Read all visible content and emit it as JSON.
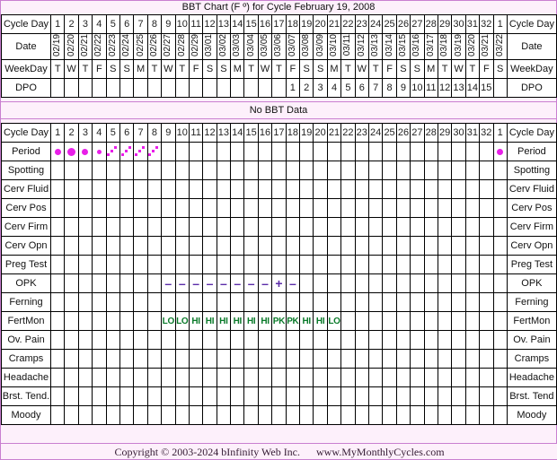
{
  "chart_data": {
    "type": "table",
    "title": "BBT Chart (F º) for Cycle February 19, 2008",
    "no_data_message": "No BBT Data",
    "cycle_days": [
      "1",
      "2",
      "3",
      "4",
      "5",
      "6",
      "7",
      "8",
      "9",
      "10",
      "11",
      "12",
      "13",
      "14",
      "15",
      "16",
      "17",
      "18",
      "19",
      "20",
      "21",
      "22",
      "23",
      "24",
      "25",
      "26",
      "27",
      "28",
      "29",
      "30",
      "31",
      "32",
      "1"
    ],
    "dates": [
      "02/19",
      "02/20",
      "02/21",
      "02/22",
      "02/23",
      "02/24",
      "02/25",
      "02/26",
      "02/27",
      "02/28",
      "02/29",
      "03/01",
      "03/02",
      "03/03",
      "03/04",
      "03/05",
      "03/06",
      "03/07",
      "03/08",
      "03/09",
      "03/10",
      "03/11",
      "03/12",
      "03/13",
      "03/14",
      "03/15",
      "03/16",
      "03/17",
      "03/18",
      "03/19",
      "03/20",
      "03/21",
      "03/22"
    ],
    "weekdays": [
      "T",
      "W",
      "T",
      "F",
      "S",
      "S",
      "M",
      "T",
      "W",
      "T",
      "F",
      "S",
      "S",
      "M",
      "T",
      "W",
      "T",
      "F",
      "S",
      "S",
      "M",
      "T",
      "W",
      "T",
      "F",
      "S",
      "S",
      "M",
      "T",
      "W",
      "T",
      "F",
      "S"
    ],
    "dpo": [
      "",
      "",
      "",
      "",
      "",
      "",
      "",
      "",
      "",
      "",
      "",
      "",
      "",
      "",
      "",
      "",
      "",
      "1",
      "2",
      "3",
      "4",
      "5",
      "6",
      "7",
      "8",
      "9",
      "10",
      "11",
      "12",
      "13",
      "14",
      "15",
      ""
    ],
    "rows": [
      {
        "label_left": "Period",
        "label_right": "Period",
        "kind": "period",
        "values": [
          "med",
          "big",
          "med",
          "sml",
          "spot",
          "spot",
          "spot",
          "spot",
          "",
          "",
          "",
          "",
          "",
          "",
          "",
          "",
          "",
          "",
          "",
          "",
          "",
          "",
          "",
          "",
          "",
          "",
          "",
          "",
          "",
          "",
          "",
          "",
          "med"
        ]
      },
      {
        "label_left": "Spotting",
        "label_right": "Spotting",
        "kind": "blank",
        "values": []
      },
      {
        "label_left": "Cerv Fluid",
        "label_right": "Cerv Fluid",
        "kind": "tall",
        "values": []
      },
      {
        "label_left": "Cerv Pos",
        "label_right": "Cerv Pos",
        "kind": "blank",
        "values": []
      },
      {
        "label_left": "Cerv Firm",
        "label_right": "Cerv Firm",
        "kind": "blank",
        "values": []
      },
      {
        "label_left": "Cerv Opn",
        "label_right": "Cerv Opn",
        "kind": "blank",
        "values": []
      },
      {
        "label_left": "Preg Test",
        "label_right": "Preg Test",
        "kind": "blank",
        "values": []
      },
      {
        "label_left": "OPK",
        "label_right": "OPK",
        "kind": "opk",
        "values": [
          "",
          "",
          "",
          "",
          "",
          "",
          "",
          "",
          "–",
          "–",
          "–",
          "–",
          "–",
          "–",
          "–",
          "–",
          "+",
          "–",
          "",
          "",
          "",
          "",
          "",
          "",
          "",
          "",
          "",
          "",
          "",
          "",
          "",
          "",
          ""
        ]
      },
      {
        "label_left": "Ferning",
        "label_right": "Ferning",
        "kind": "blank",
        "values": []
      },
      {
        "label_left": "FertMon",
        "label_right": "FertMon",
        "kind": "fertmon",
        "values": [
          "",
          "",
          "",
          "",
          "",
          "",
          "",
          "",
          "LO",
          "LO",
          "HI",
          "HI",
          "HI",
          "HI",
          "HI",
          "HI",
          "PK",
          "PK",
          "HI",
          "HI",
          "LO",
          "",
          "",
          "",
          "",
          "",
          "",
          "",
          "",
          "",
          "",
          "",
          ""
        ]
      },
      {
        "label_left": "Ov. Pain",
        "label_right": "Ov. Pain",
        "kind": "blank",
        "values": []
      },
      {
        "label_left": "Cramps",
        "label_right": "Cramps",
        "kind": "blank",
        "values": []
      },
      {
        "label_left": "Headache",
        "label_right": "Headache",
        "kind": "blank",
        "values": []
      },
      {
        "label_left": "Brst. Tend.",
        "label_right": "Brst. Tend",
        "kind": "blank",
        "values": []
      },
      {
        "label_left": "Moody",
        "label_right": "Moody",
        "kind": "blank",
        "values": []
      }
    ],
    "header_rows": {
      "cycle_day_label": "Cycle Day",
      "date_label": "Date",
      "weekday_label": "WeekDay",
      "dpo_label": "DPO"
    },
    "colors": {
      "period": "#e81ee8",
      "opk": "#5b2ca8",
      "fertmon": "#0a7a2a",
      "frame": "#c97fd0",
      "label_bg": "#fdf0fb",
      "header_bg": "#ececec",
      "date_bg": "#fcfbe8"
    }
  },
  "footer": {
    "copyright": "Copyright © 2003-2024 bInfinity Web Inc.",
    "website": "www.MyMonthlyCycles.com"
  }
}
